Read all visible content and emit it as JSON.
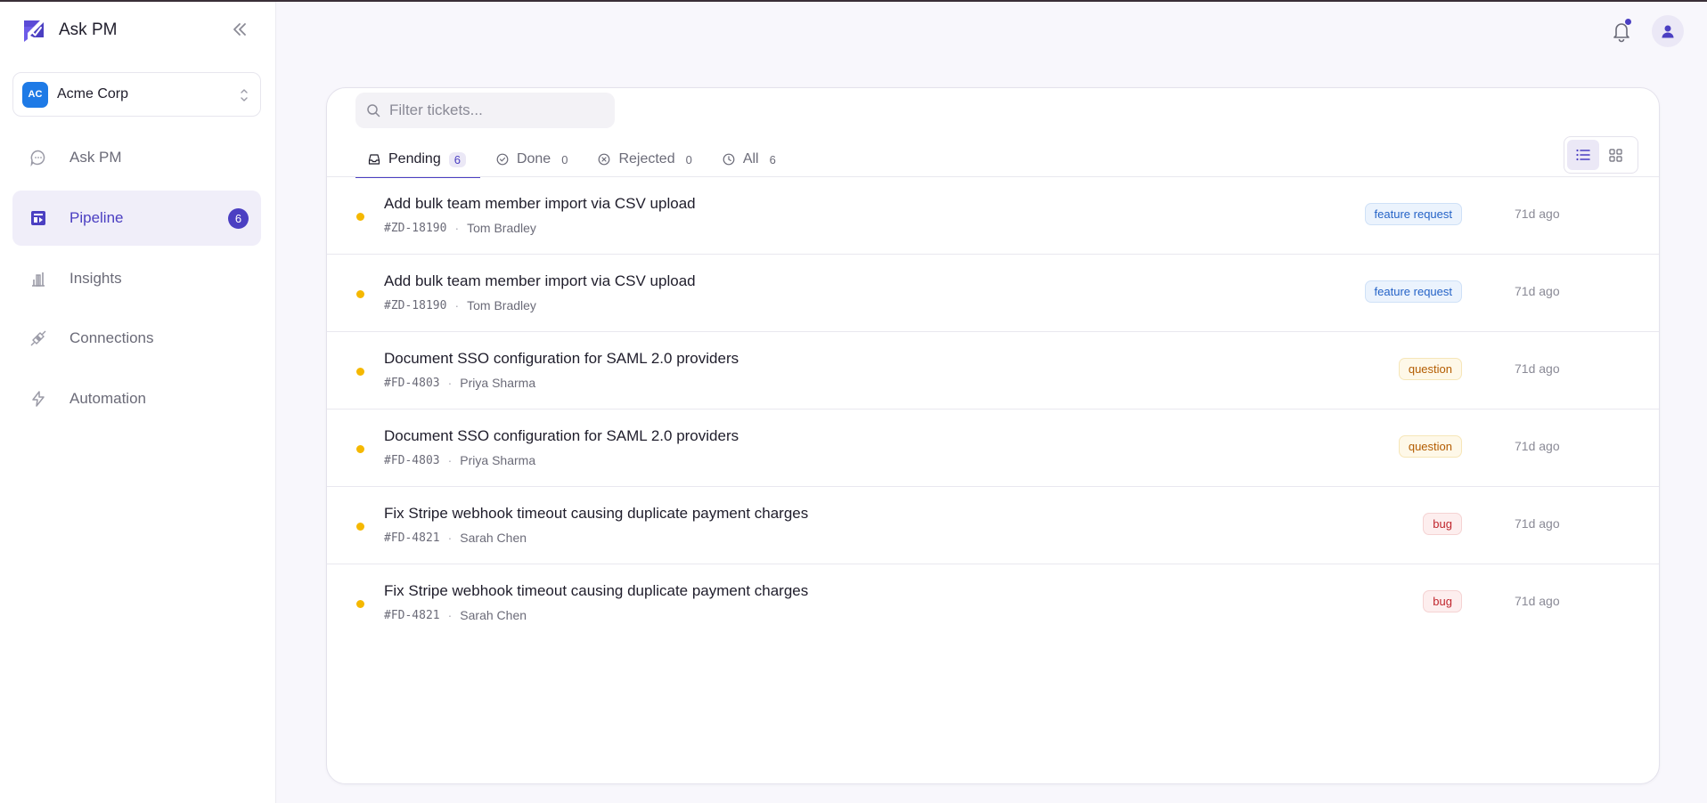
{
  "brand": {
    "name": "Ask PM"
  },
  "org": {
    "initials": "AC",
    "name": "Acme Corp"
  },
  "nav": [
    {
      "label": "Ask PM",
      "icon": "chat-bubble-icon"
    },
    {
      "label": "Pipeline",
      "icon": "pipeline-icon",
      "badge": "6",
      "active": true
    },
    {
      "label": "Insights",
      "icon": "bar-chart-icon"
    },
    {
      "label": "Connections",
      "icon": "plug-icon"
    },
    {
      "label": "Automation",
      "icon": "lightning-icon"
    }
  ],
  "search": {
    "placeholder": "Filter tickets..."
  },
  "tabs": [
    {
      "label": "Pending",
      "count": "6",
      "icon": "inbox-icon"
    },
    {
      "label": "Done",
      "count": "0",
      "icon": "check-circle-icon"
    },
    {
      "label": "Rejected",
      "count": "0",
      "icon": "x-circle-icon"
    },
    {
      "label": "All",
      "count": "6",
      "icon": "clock-icon"
    }
  ],
  "view": {
    "selected": "list"
  },
  "tickets": [
    {
      "title": "Add bulk team member import via CSV upload",
      "id": "#ZD-18190",
      "author": "Tom Bradley",
      "tag": "feature request",
      "tag_type": "feature",
      "time": "71d ago"
    },
    {
      "title": "Add bulk team member import via CSV upload",
      "id": "#ZD-18190",
      "author": "Tom Bradley",
      "tag": "feature request",
      "tag_type": "feature",
      "time": "71d ago"
    },
    {
      "title": "Document SSO configuration for SAML 2.0 providers",
      "id": "#FD-4803",
      "author": "Priya Sharma",
      "tag": "question",
      "tag_type": "question",
      "time": "71d ago"
    },
    {
      "title": "Document SSO configuration for SAML 2.0 providers",
      "id": "#FD-4803",
      "author": "Priya Sharma",
      "tag": "question",
      "tag_type": "question",
      "time": "71d ago"
    },
    {
      "title": "Fix Stripe webhook timeout causing duplicate payment charges",
      "id": "#FD-4821",
      "author": "Sarah Chen",
      "tag": "bug",
      "tag_type": "bug",
      "time": "71d ago"
    },
    {
      "title": "Fix Stripe webhook timeout causing duplicate payment charges",
      "id": "#FD-4821",
      "author": "Sarah Chen",
      "tag": "bug",
      "tag_type": "bug",
      "time": "71d ago"
    }
  ],
  "colors": {
    "accent": "#4b3fc2",
    "status_pending": "#f5b800",
    "org_avatar": "#1e7ae6"
  }
}
